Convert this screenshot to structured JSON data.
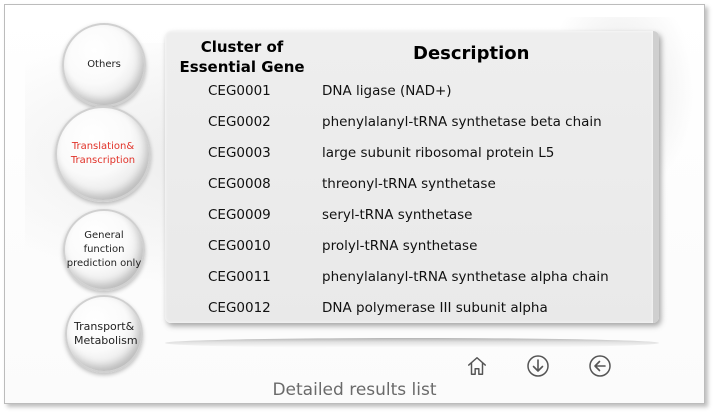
{
  "sidebar": {
    "items": [
      {
        "label": "Others",
        "active": false
      },
      {
        "label": "Translation& Transcription",
        "active": true
      },
      {
        "label": "General function prediction only",
        "active": false
      },
      {
        "label": "Transport& Metabolism",
        "active": false
      }
    ]
  },
  "table": {
    "header_gene": "Cluster of Essential Gene",
    "header_desc": "Description",
    "rows": [
      {
        "gene": "CEG0001",
        "desc": "DNA ligase (NAD+)"
      },
      {
        "gene": "CEG0002",
        "desc": "phenylalanyl-tRNA synthetase beta chain"
      },
      {
        "gene": "CEG0003",
        "desc": "large subunit ribosomal protein L5"
      },
      {
        "gene": "CEG0008",
        "desc": "threonyl-tRNA synthetase"
      },
      {
        "gene": "CEG0009",
        "desc": "seryl-tRNA synthetase"
      },
      {
        "gene": "CEG0010",
        "desc": "prolyl-tRNA synthetase"
      },
      {
        "gene": "CEG0011",
        "desc": "phenylalanyl-tRNA synthetase alpha chain"
      },
      {
        "gene": "CEG0012",
        "desc": "DNA polymerase III subunit alpha"
      }
    ]
  },
  "nav": {
    "icons": [
      "home-icon",
      "down-arrow-icon",
      "back-arrow-icon"
    ]
  },
  "caption": "Detailed results list",
  "colors": {
    "active_text": "#e1332a",
    "caption": "#6a6a6a"
  }
}
